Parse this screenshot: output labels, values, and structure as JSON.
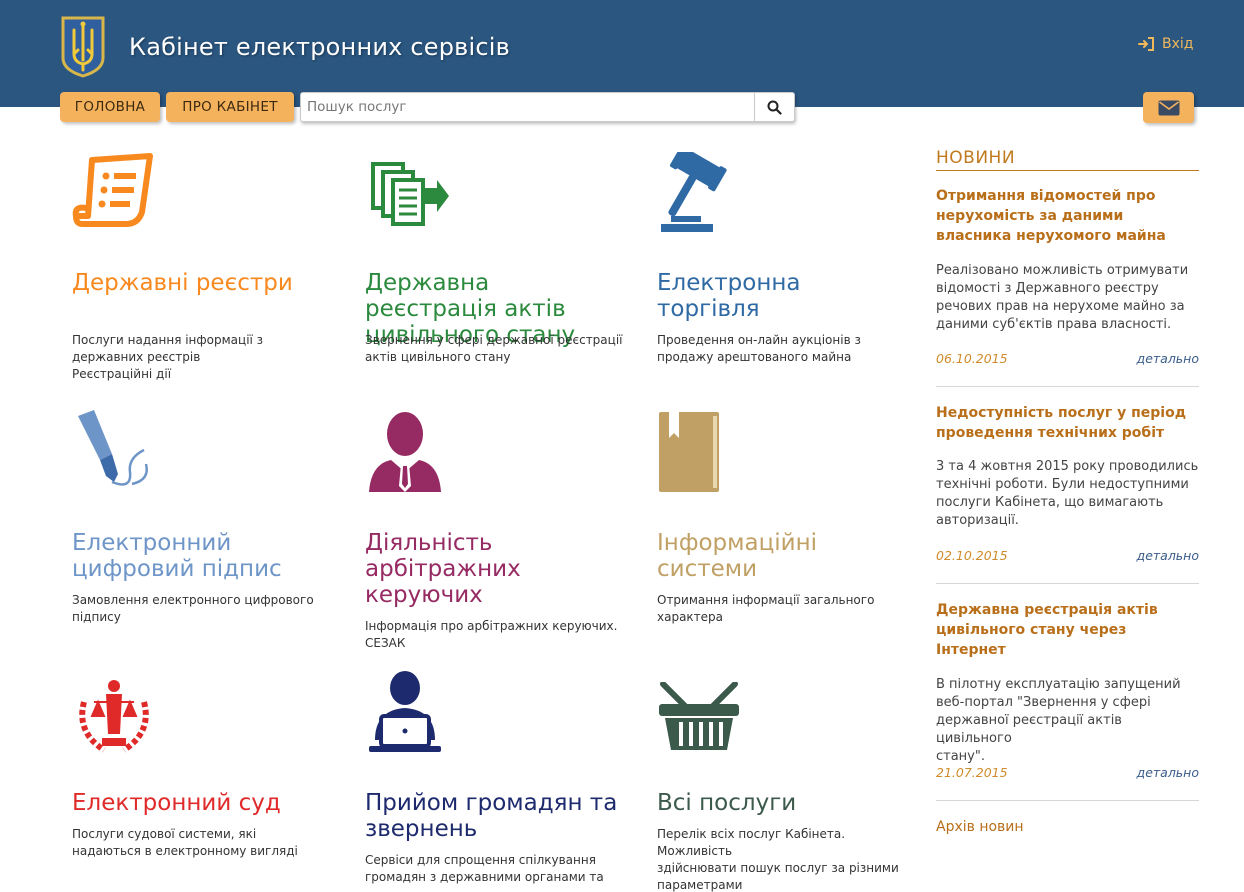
{
  "header": {
    "title": "Кабінет електронних сервісів",
    "login_label": "Вхід"
  },
  "nav": {
    "home": "ГОЛОВНА",
    "about": "ПРО КАБІНЕТ",
    "search_placeholder": "Пошук послуг"
  },
  "tiles": [
    {
      "title": [
        "Державні реєстри"
      ],
      "desc": [
        "Послуги надання інформації з",
        "державних реєстрів",
        "Реєстраційні дії"
      ],
      "color": "#f7891f",
      "icon": "document-list-icon"
    },
    {
      "title": [
        "Державна",
        "реєстрація актів",
        "цивільного стану"
      ],
      "desc": [
        "Звернення у сфері державної реєстрації",
        "актів цивільного стану"
      ],
      "color": "#2b8a3e",
      "icon": "documents-arrow-icon"
    },
    {
      "title": [
        "Електронна",
        "торгівля"
      ],
      "desc": [
        "Проведення он-лайн аукціонів з",
        "продажу арештованого майна"
      ],
      "color": "#2f6aa5",
      "icon": "gavel-icon"
    },
    {
      "title": [
        "Електронний",
        "цифровий підпис"
      ],
      "desc": [
        "Замовлення електронного цифрового",
        "підпису"
      ],
      "color": "#6e95c8",
      "icon": "pen-signature-icon"
    },
    {
      "title": [
        "Діяльність",
        "арбітражних",
        "керуючих"
      ],
      "desc": [
        "Інформація про арбітражних керуючих.",
        "СЕЗАК"
      ],
      "color": "#962a62",
      "icon": "manager-person-icon"
    },
    {
      "title": [
        "Інформаційні",
        "системи"
      ],
      "desc": [
        "Отримання інформації загального",
        "характера"
      ],
      "color": "#c0a064",
      "icon": "book-icon"
    },
    {
      "title": [
        "Електронний суд"
      ],
      "desc": [
        "Послуги судової системи, які",
        "надаються в електронному вигляді"
      ],
      "color": "#e02a2a",
      "icon": "justice-icon"
    },
    {
      "title": [
        "Прийом громадян та",
        "звернень"
      ],
      "desc": [
        "Сервіси для спрощення спілкування",
        "громадян з державними органами та"
      ],
      "color": "#1e2a6e",
      "icon": "person-laptop-icon"
    },
    {
      "title": [
        "Всі послуги"
      ],
      "desc": [
        "Перелік всіх послуг Кабінета. Можливість",
        "здійснювати пошук послуг за різними",
        "параметрами"
      ],
      "color": "#3b5a4c",
      "icon": "basket-icon"
    }
  ],
  "news": {
    "header": "НОВИНИ",
    "items": [
      {
        "title": [
          "Отримання відомостей про",
          "нерухомість за даними",
          "власника нерухомого майна"
        ],
        "text": [
          "Реалізовано можливість отримувати",
          "відомості з Державного реєстру",
          "речових прав на нерухоме майно за",
          "даними суб'єктів права власності."
        ],
        "date": "06.10.2015",
        "more": "детально"
      },
      {
        "title": [
          "Недоступність послуг у період",
          "проведення технічних робіт"
        ],
        "text": [
          "3 та 4 жовтня 2015 року проводились",
          "технічні роботи. Були недоступними",
          "послуги Кабінета, що вимагають",
          "авторизації."
        ],
        "date": "02.10.2015",
        "more": "детально"
      },
      {
        "title": [
          "Державна реєстрація актів",
          "цивільного стану через",
          "Інтернет"
        ],
        "text": [
          "В пілотну експлуатацію запущений",
          "веб-портал \"Звернення у сфері",
          "державної реєстрації актів цивільного",
          "стану\"."
        ],
        "date": "21.07.2015",
        "more": "детально"
      }
    ],
    "archive": "Архів новин"
  },
  "colors": {
    "header_bg": "#2a5680",
    "accent": "#f5b25d",
    "news_accent": "#b96f1a"
  }
}
